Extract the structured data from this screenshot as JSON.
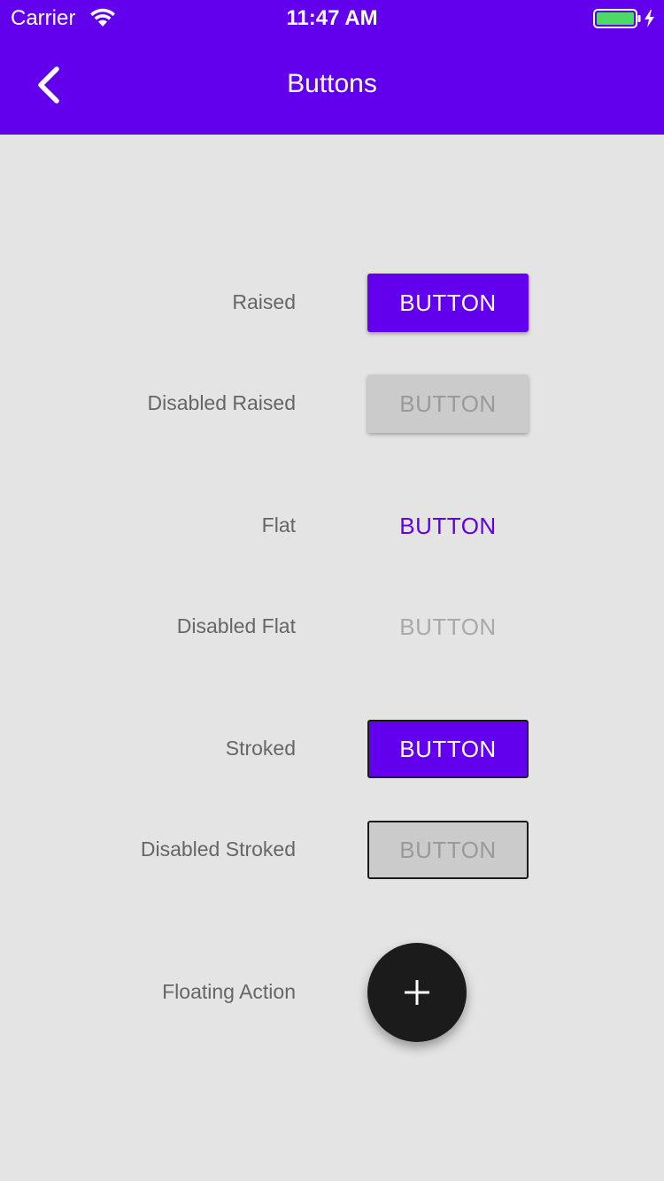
{
  "status_bar": {
    "carrier": "Carrier",
    "time": "11:47 AM",
    "wifi_icon": "wifi-icon",
    "battery_icon": "battery-charging-icon"
  },
  "nav_bar": {
    "title": "Buttons",
    "back_icon": "chevron-left-icon",
    "background": "#6200ee"
  },
  "colors": {
    "accent": "#6200ee",
    "background": "#e4e4e4",
    "disabled_fill": "#cbcbcb",
    "fab": "#1b1b1b",
    "battery": "#4cd964"
  },
  "rows": {
    "raised": {
      "label": "Raised",
      "button": "BUTTON"
    },
    "disabled_raised": {
      "label": "Disabled Raised",
      "button": "BUTTON"
    },
    "flat": {
      "label": "Flat",
      "button": "BUTTON"
    },
    "disabled_flat": {
      "label": "Disabled Flat",
      "button": "BUTTON"
    },
    "stroked": {
      "label": "Stroked",
      "button": "BUTTON"
    },
    "disabled_stroked": {
      "label": "Disabled Stroked",
      "button": "BUTTON"
    },
    "floating_action": {
      "label": "Floating Action",
      "icon": "plus-icon"
    }
  }
}
